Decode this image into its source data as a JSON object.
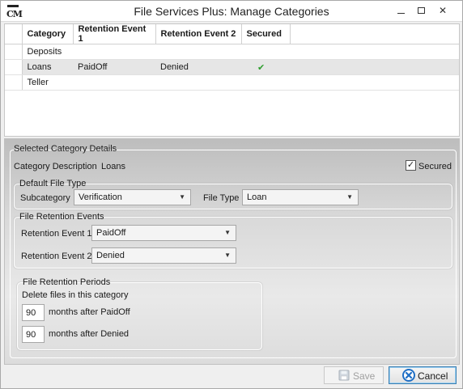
{
  "window": {
    "title": "File Services Plus: Manage Categories",
    "logo_text": "CM"
  },
  "grid": {
    "columns": [
      "Category",
      "Retention Event 1",
      "Retention Event 2",
      "Secured"
    ],
    "rows": [
      {
        "category": "Deposits",
        "event1": "",
        "event2": "",
        "secured": false
      },
      {
        "category": "Loans",
        "event1": "PaidOff",
        "event2": "Denied",
        "secured": true,
        "check_glyph": "✔"
      },
      {
        "category": "Teller",
        "event1": "",
        "event2": "",
        "secured": false
      }
    ]
  },
  "details": {
    "section_title": "Selected Category Details",
    "category_description_label": "Category Description",
    "category_description_value": "Loans",
    "secured_label": "Secured",
    "secured_checked": true,
    "secured_glyph": "✓",
    "default_file_type": {
      "title": "Default File Type",
      "subcategory_label": "Subcategory",
      "subcategory_value": "Verification",
      "file_type_label": "File Type",
      "file_type_value": "Loan"
    },
    "retention_events": {
      "title": "File Retention Events",
      "event1_label": "Retention Event 1",
      "event1_value": "PaidOff",
      "event2_label": "Retention Event 2",
      "event2_value": "Denied"
    },
    "retention_periods": {
      "title": "File Retention Periods",
      "subtitle": "Delete files in this category",
      "period1_value": "90",
      "period1_label": "months after PaidOff",
      "period2_value": "90",
      "period2_label": "months after Denied"
    }
  },
  "footer": {
    "save_label": "Save",
    "cancel_label": "Cancel"
  },
  "colors": {
    "check_green": "#2e9e2e",
    "cancel_icon_blue": "#1f6fc5"
  }
}
